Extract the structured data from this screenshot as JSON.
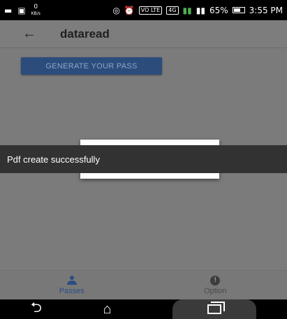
{
  "status_bar": {
    "network_speed": "0",
    "network_speed_unit": "KB/s",
    "network_badge_vo": "VO LTE",
    "network_badge_4g": "4G",
    "battery_percent": "65%",
    "battery_level": 0.65,
    "time": "3:55 PM"
  },
  "toolbar": {
    "back_icon": "arrow-left-icon",
    "title": "dataread"
  },
  "main": {
    "generate_button_label": "GENERATE YOUR PASS"
  },
  "toast": {
    "message": "Pdf create successfully"
  },
  "bottom_nav": {
    "items": [
      {
        "label": "Passes",
        "icon": "person-icon",
        "active": true
      },
      {
        "label": "Option",
        "icon": "alert-circle-icon",
        "active": false
      }
    ]
  },
  "system_nav": {
    "back_icon": "back-icon",
    "home_icon": "home-icon",
    "recents_icon": "recents-icon"
  },
  "colors": {
    "scrim_background": "#7b7b7b",
    "primary_dimmed": "#2c4c7c",
    "toast_background": "#323232"
  }
}
